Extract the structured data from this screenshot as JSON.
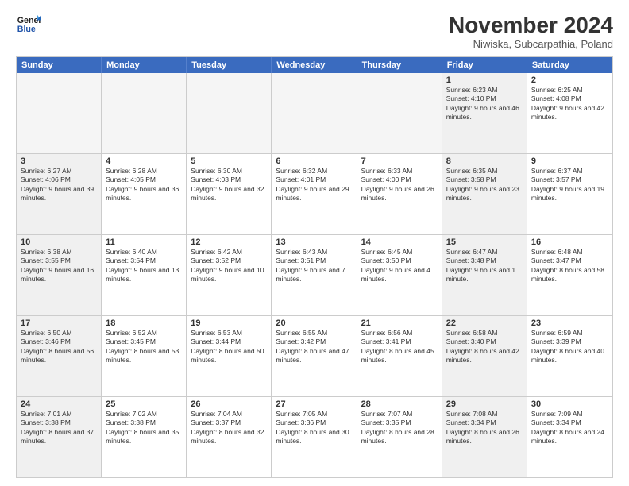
{
  "header": {
    "logo_line1": "General",
    "logo_line2": "Blue",
    "month": "November 2024",
    "location": "Niwiska, Subcarpathia, Poland"
  },
  "calendar": {
    "days_of_week": [
      "Sunday",
      "Monday",
      "Tuesday",
      "Wednesday",
      "Thursday",
      "Friday",
      "Saturday"
    ],
    "rows": [
      [
        {
          "day": "",
          "info": "",
          "empty": true
        },
        {
          "day": "",
          "info": "",
          "empty": true
        },
        {
          "day": "",
          "info": "",
          "empty": true
        },
        {
          "day": "",
          "info": "",
          "empty": true
        },
        {
          "day": "",
          "info": "",
          "empty": true
        },
        {
          "day": "1",
          "info": "Sunrise: 6:23 AM\nSunset: 4:10 PM\nDaylight: 9 hours and 46 minutes.",
          "shaded": true
        },
        {
          "day": "2",
          "info": "Sunrise: 6:25 AM\nSunset: 4:08 PM\nDaylight: 9 hours and 42 minutes.",
          "shaded": false
        }
      ],
      [
        {
          "day": "3",
          "info": "Sunrise: 6:27 AM\nSunset: 4:06 PM\nDaylight: 9 hours and 39 minutes.",
          "shaded": true
        },
        {
          "day": "4",
          "info": "Sunrise: 6:28 AM\nSunset: 4:05 PM\nDaylight: 9 hours and 36 minutes.",
          "shaded": false
        },
        {
          "day": "5",
          "info": "Sunrise: 6:30 AM\nSunset: 4:03 PM\nDaylight: 9 hours and 32 minutes.",
          "shaded": false
        },
        {
          "day": "6",
          "info": "Sunrise: 6:32 AM\nSunset: 4:01 PM\nDaylight: 9 hours and 29 minutes.",
          "shaded": false
        },
        {
          "day": "7",
          "info": "Sunrise: 6:33 AM\nSunset: 4:00 PM\nDaylight: 9 hours and 26 minutes.",
          "shaded": false
        },
        {
          "day": "8",
          "info": "Sunrise: 6:35 AM\nSunset: 3:58 PM\nDaylight: 9 hours and 23 minutes.",
          "shaded": true
        },
        {
          "day": "9",
          "info": "Sunrise: 6:37 AM\nSunset: 3:57 PM\nDaylight: 9 hours and 19 minutes.",
          "shaded": false
        }
      ],
      [
        {
          "day": "10",
          "info": "Sunrise: 6:38 AM\nSunset: 3:55 PM\nDaylight: 9 hours and 16 minutes.",
          "shaded": true
        },
        {
          "day": "11",
          "info": "Sunrise: 6:40 AM\nSunset: 3:54 PM\nDaylight: 9 hours and 13 minutes.",
          "shaded": false
        },
        {
          "day": "12",
          "info": "Sunrise: 6:42 AM\nSunset: 3:52 PM\nDaylight: 9 hours and 10 minutes.",
          "shaded": false
        },
        {
          "day": "13",
          "info": "Sunrise: 6:43 AM\nSunset: 3:51 PM\nDaylight: 9 hours and 7 minutes.",
          "shaded": false
        },
        {
          "day": "14",
          "info": "Sunrise: 6:45 AM\nSunset: 3:50 PM\nDaylight: 9 hours and 4 minutes.",
          "shaded": false
        },
        {
          "day": "15",
          "info": "Sunrise: 6:47 AM\nSunset: 3:48 PM\nDaylight: 9 hours and 1 minute.",
          "shaded": true
        },
        {
          "day": "16",
          "info": "Sunrise: 6:48 AM\nSunset: 3:47 PM\nDaylight: 8 hours and 58 minutes.",
          "shaded": false
        }
      ],
      [
        {
          "day": "17",
          "info": "Sunrise: 6:50 AM\nSunset: 3:46 PM\nDaylight: 8 hours and 56 minutes.",
          "shaded": true
        },
        {
          "day": "18",
          "info": "Sunrise: 6:52 AM\nSunset: 3:45 PM\nDaylight: 8 hours and 53 minutes.",
          "shaded": false
        },
        {
          "day": "19",
          "info": "Sunrise: 6:53 AM\nSunset: 3:44 PM\nDaylight: 8 hours and 50 minutes.",
          "shaded": false
        },
        {
          "day": "20",
          "info": "Sunrise: 6:55 AM\nSunset: 3:42 PM\nDaylight: 8 hours and 47 minutes.",
          "shaded": false
        },
        {
          "day": "21",
          "info": "Sunrise: 6:56 AM\nSunset: 3:41 PM\nDaylight: 8 hours and 45 minutes.",
          "shaded": false
        },
        {
          "day": "22",
          "info": "Sunrise: 6:58 AM\nSunset: 3:40 PM\nDaylight: 8 hours and 42 minutes.",
          "shaded": true
        },
        {
          "day": "23",
          "info": "Sunrise: 6:59 AM\nSunset: 3:39 PM\nDaylight: 8 hours and 40 minutes.",
          "shaded": false
        }
      ],
      [
        {
          "day": "24",
          "info": "Sunrise: 7:01 AM\nSunset: 3:38 PM\nDaylight: 8 hours and 37 minutes.",
          "shaded": true
        },
        {
          "day": "25",
          "info": "Sunrise: 7:02 AM\nSunset: 3:38 PM\nDaylight: 8 hours and 35 minutes.",
          "shaded": false
        },
        {
          "day": "26",
          "info": "Sunrise: 7:04 AM\nSunset: 3:37 PM\nDaylight: 8 hours and 32 minutes.",
          "shaded": false
        },
        {
          "day": "27",
          "info": "Sunrise: 7:05 AM\nSunset: 3:36 PM\nDaylight: 8 hours and 30 minutes.",
          "shaded": false
        },
        {
          "day": "28",
          "info": "Sunrise: 7:07 AM\nSunset: 3:35 PM\nDaylight: 8 hours and 28 minutes.",
          "shaded": false
        },
        {
          "day": "29",
          "info": "Sunrise: 7:08 AM\nSunset: 3:34 PM\nDaylight: 8 hours and 26 minutes.",
          "shaded": true
        },
        {
          "day": "30",
          "info": "Sunrise: 7:09 AM\nSunset: 3:34 PM\nDaylight: 8 hours and 24 minutes.",
          "shaded": false
        }
      ]
    ]
  }
}
